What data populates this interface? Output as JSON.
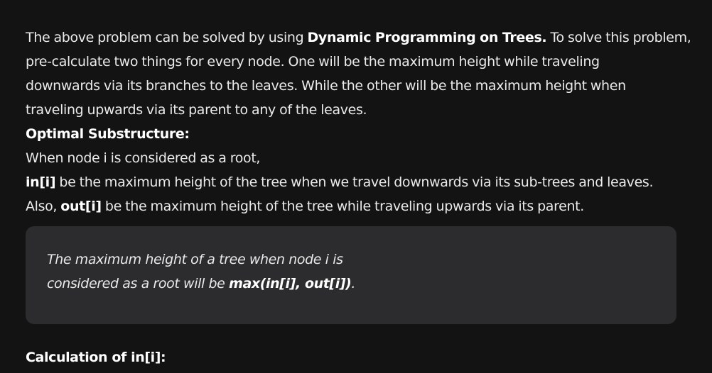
{
  "intro": {
    "line1_a": "The above problem can be solved by using ",
    "line1_bold": "Dynamic Programming on Trees.",
    "line1_b": " To solve this problem,",
    "line2": "pre-calculate two things for every node. One will be the maximum height while traveling",
    "line3": "downwards via its branches to the leaves. While the other will be the maximum height when",
    "line4": "traveling upwards via its parent to any of the leaves."
  },
  "optimal_substructure": {
    "heading": "Optimal Substructure:",
    "line1": "When node i is considered as a root,",
    "in_term": "in[i]",
    "in_desc": " be the maximum height of the tree when we travel downwards via its sub-trees and leaves.",
    "also": "Also, ",
    "out_term": "out[i]",
    "out_desc": " be the maximum height of the tree while traveling upwards via its parent."
  },
  "callout": {
    "line1": "The maximum height of a tree when node i is",
    "line2_a": "considered as a root will be ",
    "line2_bold": "max(in[i], out[i])",
    "line2_b": "."
  },
  "calculation_heading": "Calculation of in[i]:"
}
